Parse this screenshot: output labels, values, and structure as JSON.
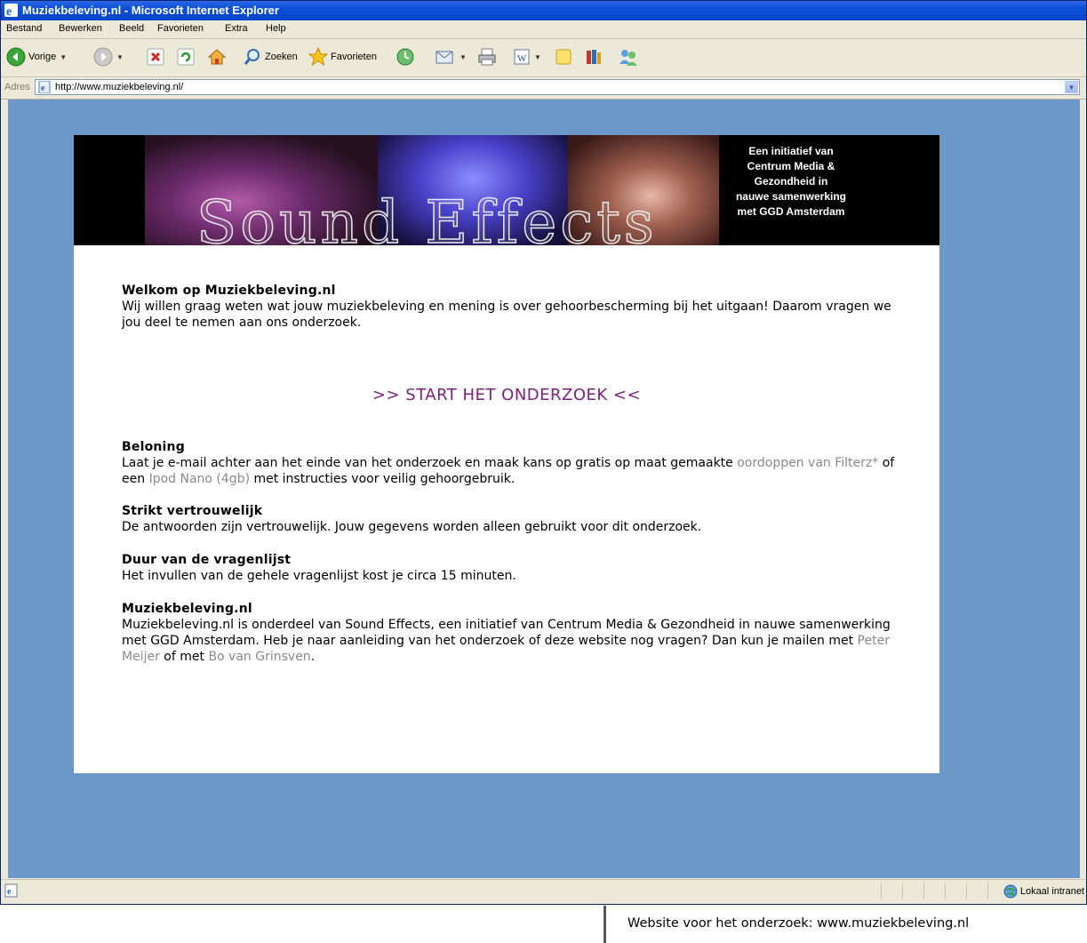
{
  "window": {
    "title": "Muziekbeleving.nl - Microsoft Internet Explorer"
  },
  "menu": [
    "Bestand",
    "Bewerken",
    "Beeld",
    "Favorieten",
    "Extra",
    "Help"
  ],
  "toolbar": {
    "back_label": "Vorige",
    "search_label": "Zoeken",
    "favorites_label": "Favorieten"
  },
  "address": {
    "label": "Adres",
    "url": "http://www.muziekbeleving.nl/"
  },
  "banner": {
    "logo_text": "Sound Effects",
    "initiative_lines": [
      "Een initiatief van",
      "Centrum Media &",
      "Gezondheid in",
      "nauwe samenwerking",
      "met GGD Amsterdam"
    ]
  },
  "welcome": {
    "heading": "Welkom op Muziekbeleving.nl",
    "text": "Wij willen graag weten wat jouw muziekbeleving en mening is over gehoorbescherming bij het uitgaan! Daarom vragen we jou deel te nemen aan ons onderzoek."
  },
  "start_link": ">> START HET ONDERZOEK <<",
  "reward": {
    "heading": "Beloning",
    "text_before": "Laat je e-mail achter aan het einde van het onderzoek en maak kans op gratis op maat gemaakte ",
    "link1": "oordoppen van Filterz*",
    "text_mid": " of een ",
    "link2": "Ipod Nano (4gb)",
    "text_after": " met instructies voor veilig gehoorgebruik."
  },
  "privacy": {
    "heading": "Strikt vertrouwelijk",
    "text": "De antwoorden zijn vertrouwelijk. Jouw gegevens worden alleen gebruikt voor dit onderzoek."
  },
  "duration": {
    "heading": "Duur van de vragenlijst",
    "text": "Het invullen van de gehele vragenlijst kost je circa 15 minuten."
  },
  "about": {
    "heading": "Muziekbeleving.nl",
    "text_before": "Muziekbeleving.nl is onderdeel van Sound Effects, een initiatief van Centrum Media & Gezondheid in nauwe samenwerking met GGD Amsterdam. Heb je naar aanleiding van het onderzoek of deze website nog vragen? Dan kun je mailen met ",
    "link1": "Peter Meijer",
    "text_mid": " of met ",
    "link2": "Bo van Grinsven",
    "text_after": "."
  },
  "status": {
    "zone": "Lokaal intranet"
  },
  "caption": "Website voor het onderzoek: www.muziekbeleving.nl",
  "colors": {
    "desktop_bg": "#6b98c8",
    "start_link": "#7d1f7d",
    "link_gray": "#8a8a8a"
  }
}
